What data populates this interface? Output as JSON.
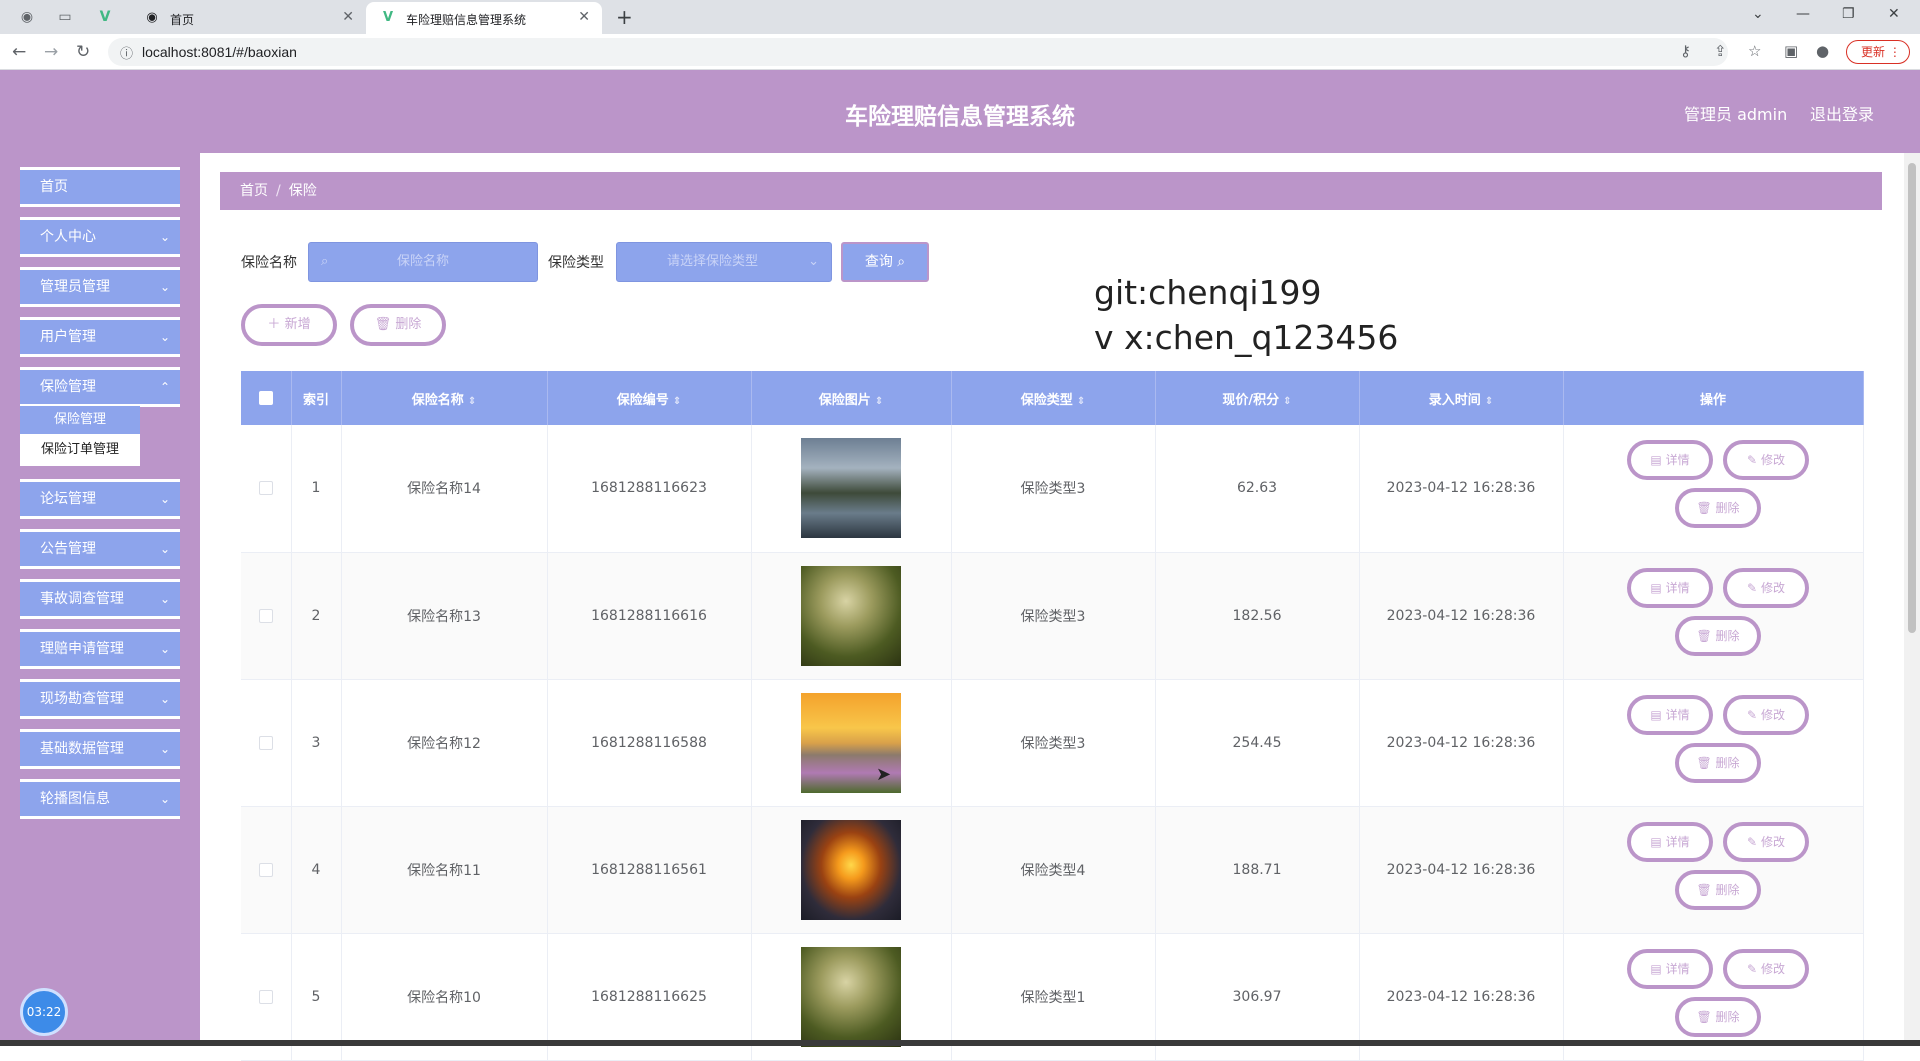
{
  "browser": {
    "tabs": [
      {
        "title": "首页"
      },
      {
        "title": "车险理赔信息管理系统"
      }
    ],
    "url": "localhost:8081/#/baoxian",
    "update_label": "更新"
  },
  "header": {
    "title": "车险理赔信息管理系统",
    "admin_label": "管理员 admin",
    "logout_label": "退出登录"
  },
  "sidebar": {
    "items": [
      {
        "label": "首页"
      },
      {
        "label": "个人中心"
      },
      {
        "label": "管理员管理"
      },
      {
        "label": "用户管理"
      },
      {
        "label": "保险管理"
      },
      {
        "label": "论坛管理"
      },
      {
        "label": "公告管理"
      },
      {
        "label": "事故调查管理"
      },
      {
        "label": "理赔申请管理"
      },
      {
        "label": "现场勘查管理"
      },
      {
        "label": "基础数据管理"
      },
      {
        "label": "轮播图信息"
      }
    ],
    "submenu": [
      {
        "label": "保险管理"
      },
      {
        "label": "保险订单管理"
      }
    ],
    "timer": "03:22"
  },
  "breadcrumb": {
    "home": "首页",
    "current": "保险"
  },
  "filters": {
    "name_label": "保险名称",
    "name_placeholder": "保险名称",
    "type_label": "保险类型",
    "type_placeholder": "请选择保险类型",
    "query_label": "查询"
  },
  "actions": {
    "add_label": "新增",
    "delete_label": "删除"
  },
  "watermark": {
    "line1": "git:chenqi199",
    "line2": "v x:chen_q123456"
  },
  "table": {
    "headers": [
      "索引",
      "保险名称",
      "保险编号",
      "保险图片",
      "保险类型",
      "现价/积分",
      "录入时间",
      "操作"
    ],
    "row_actions": {
      "detail": "详情",
      "edit": "修改",
      "delete": "删除"
    },
    "rows": [
      {
        "index": "1",
        "name": "保险名称14",
        "code": "1681288116623",
        "image": "lake-village",
        "type": "保险类型3",
        "price": "62.63",
        "time": "2023-04-12 16:28:36"
      },
      {
        "index": "2",
        "name": "保险名称13",
        "code": "1681288116616",
        "image": "forest-path",
        "type": "保险类型3",
        "price": "182.56",
        "time": "2023-04-12 16:28:36"
      },
      {
        "index": "3",
        "name": "保险名称12",
        "code": "1681288116588",
        "image": "sunset-meadow",
        "type": "保险类型3",
        "price": "254.45",
        "time": "2023-04-12 16:28:36"
      },
      {
        "index": "4",
        "name": "保险名称11",
        "code": "1681288116561",
        "image": "sunset-road",
        "type": "保险类型4",
        "price": "188.71",
        "time": "2023-04-12 16:28:36"
      },
      {
        "index": "5",
        "name": "保险名称10",
        "code": "1681288116625",
        "image": "forest-path",
        "type": "保险类型1",
        "price": "306.97",
        "time": "2023-04-12 16:28:36"
      }
    ]
  },
  "colors": {
    "header": "#bb95c9",
    "accent": "#8da4ec"
  }
}
